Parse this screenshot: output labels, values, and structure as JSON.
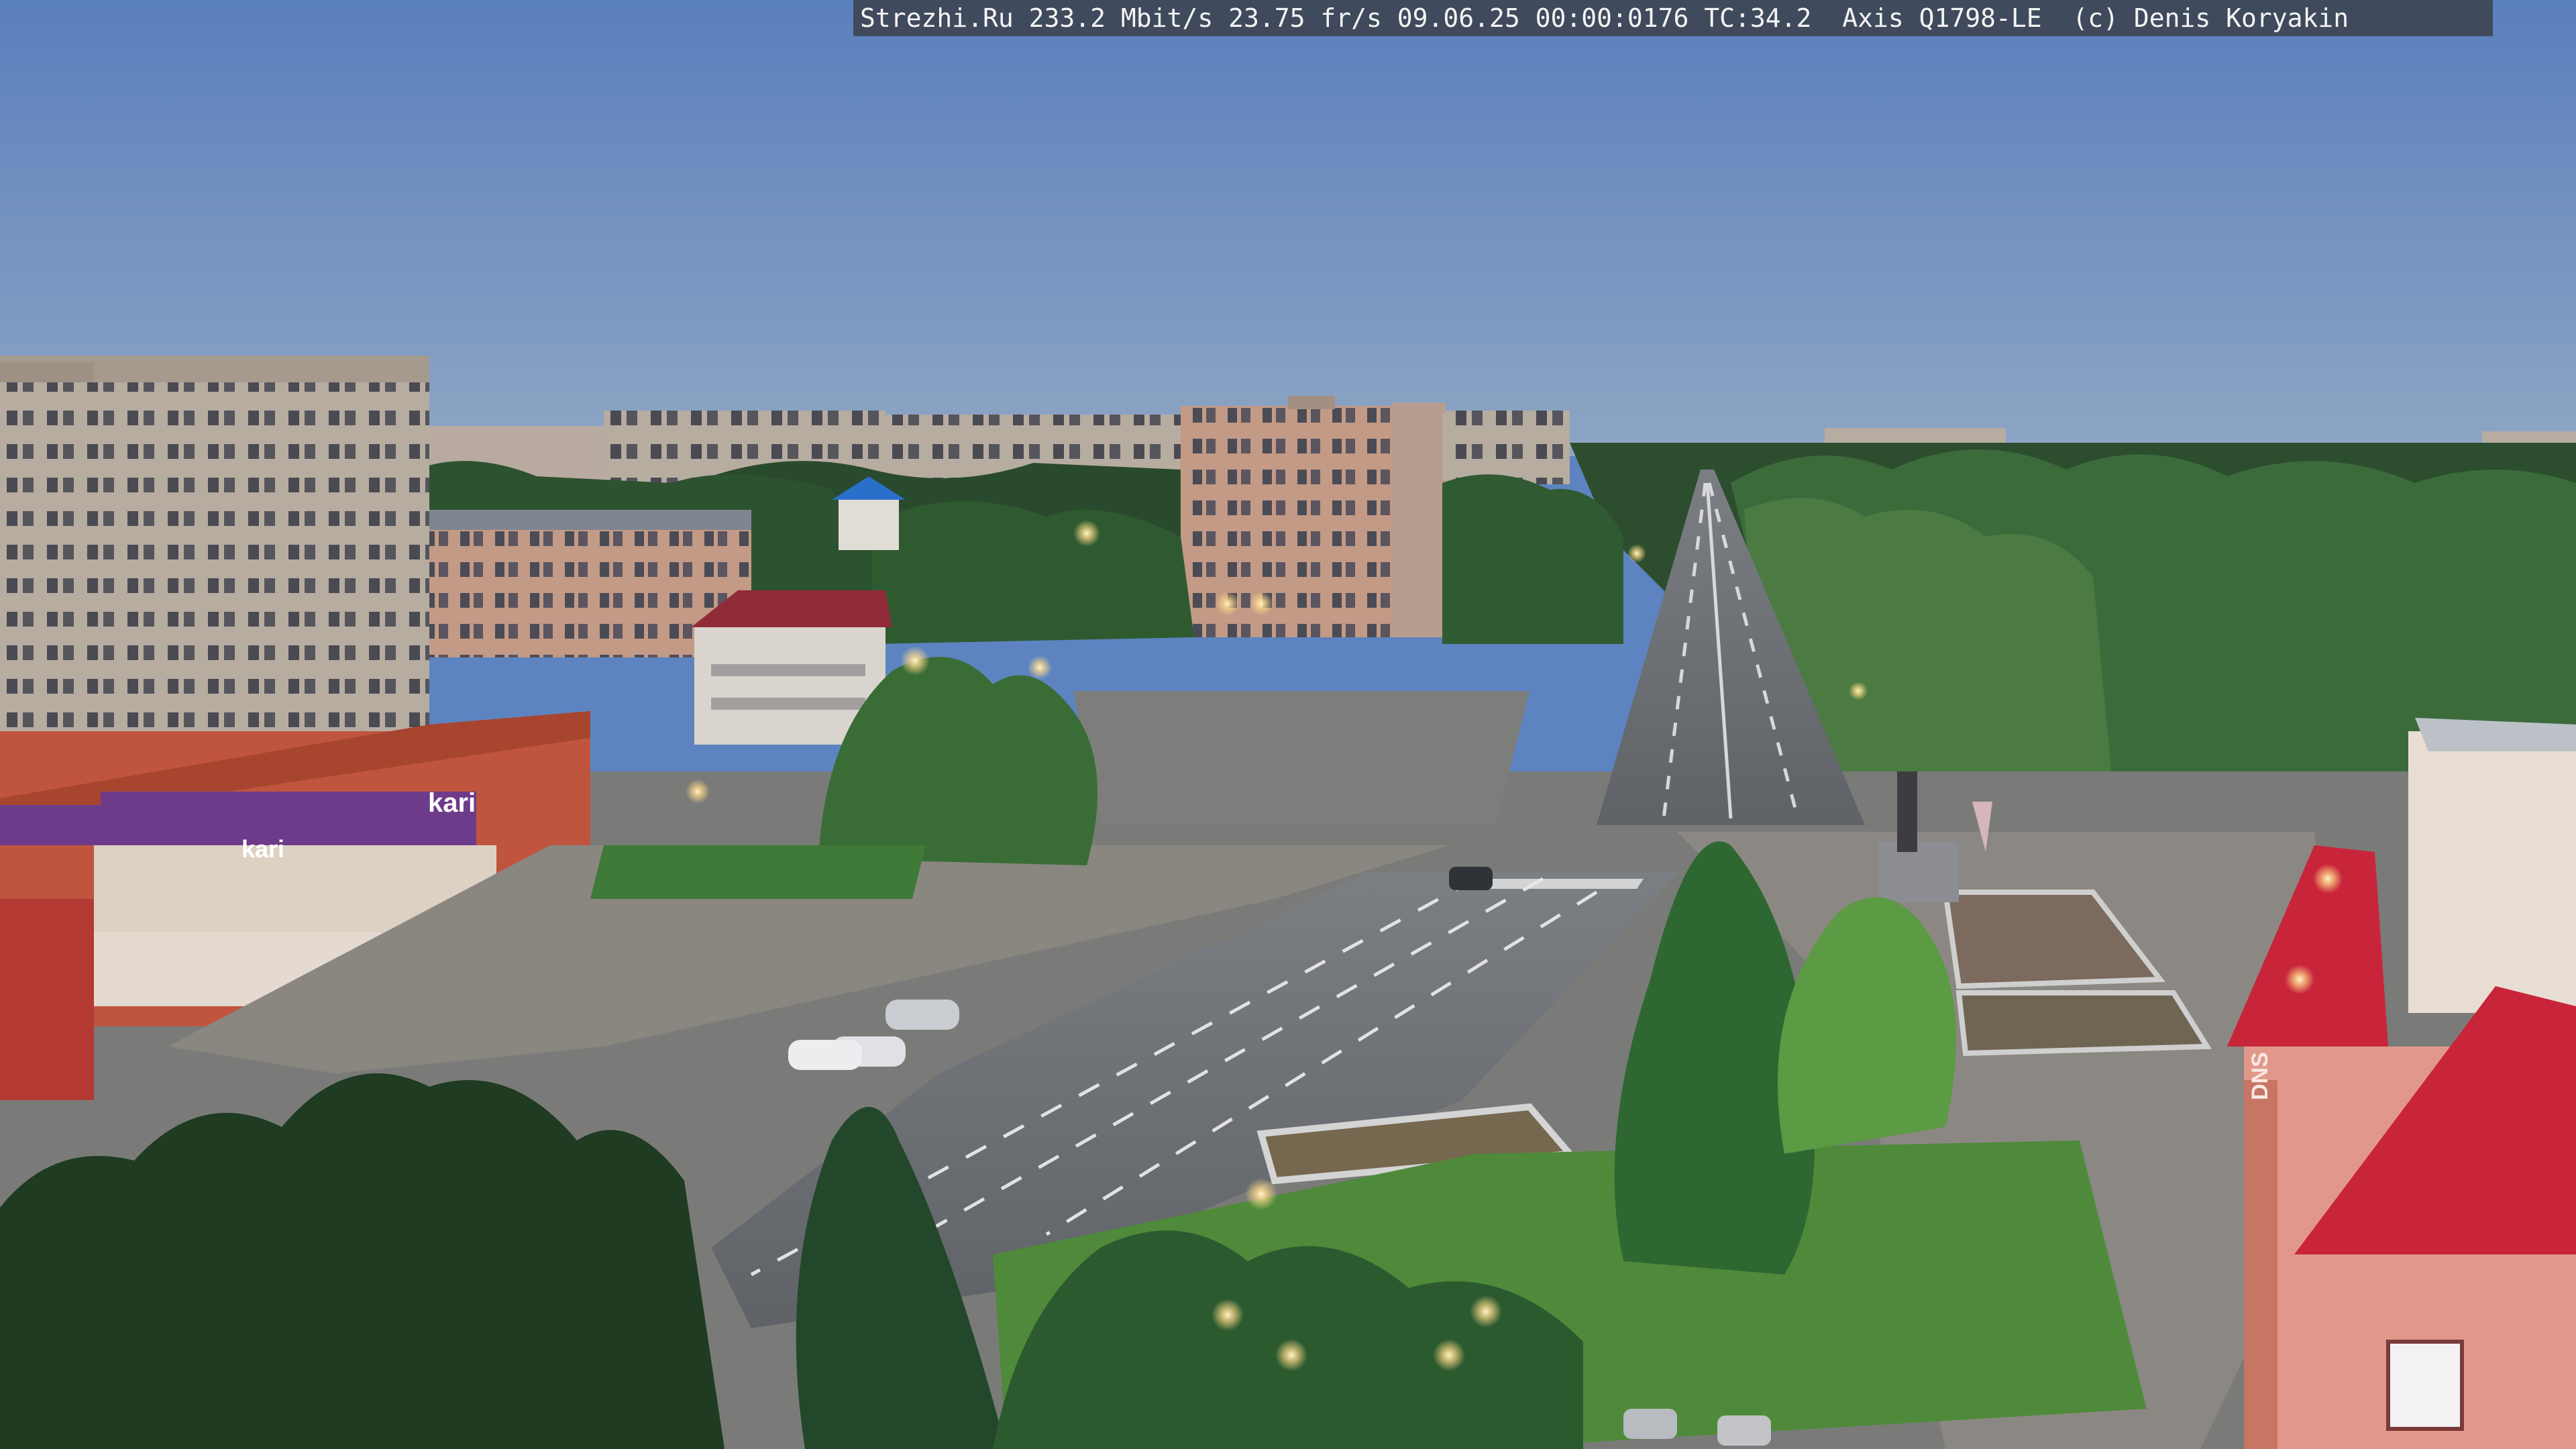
{
  "overlay": {
    "text": "Strezhi.Ru 233.2 Mbit/s 23.75 fr/s 09.06.25 00:00:0176 TC:34.2  Axis Q1798-LE  (c) Denis Koryakin"
  },
  "signs": {
    "store_kari": "kari",
    "store_kari_small": "kari",
    "store_dns": "DNS"
  },
  "colors": {
    "sky_top": "#5a7fbd",
    "sky_horizon": "#8fa3bb",
    "tree_dark": "#1f3a22",
    "tree_mid": "#2e5a2e",
    "asphalt": "#6c6f74",
    "plaza": "#7b7b79",
    "brick_red": "#c0553f",
    "panel_beige": "#b9ab9e",
    "roof_red": "#c8253a"
  }
}
